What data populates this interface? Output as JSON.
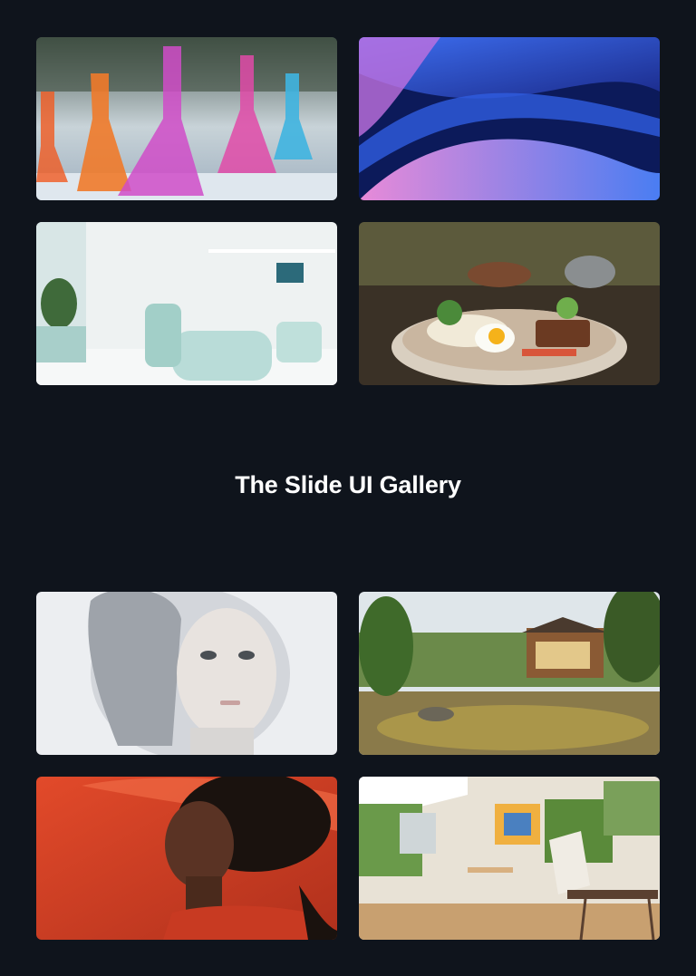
{
  "gallery": {
    "title": "The Slide UI Gallery",
    "top_images": [
      {
        "subject": "lab-flasks"
      },
      {
        "subject": "abstract-waves"
      },
      {
        "subject": "dental-clinic"
      },
      {
        "subject": "rice-bowl"
      }
    ],
    "bottom_images": [
      {
        "subject": "android-face"
      },
      {
        "subject": "garden-pond-house"
      },
      {
        "subject": "woman-red-fabric"
      },
      {
        "subject": "art-studio"
      }
    ]
  }
}
